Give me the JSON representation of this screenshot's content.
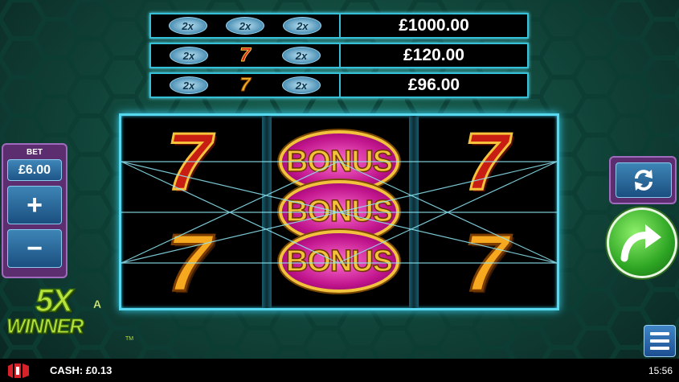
{
  "paytable": {
    "rows": [
      {
        "symbols": [
          "2x",
          "2x",
          "2x"
        ],
        "prize": "£1000.00"
      },
      {
        "symbols": [
          "2x",
          "7",
          "2x"
        ],
        "prize": "£120.00"
      },
      {
        "symbols": [
          "2x",
          "7",
          "2x"
        ],
        "prize": "£96.00"
      }
    ]
  },
  "reels": {
    "bonus_label": "BONUS",
    "seven_label": "7"
  },
  "bet": {
    "label": "BET",
    "value": "£6.00",
    "plus_label": "+",
    "minus_label": "−"
  },
  "logo": {
    "line1": "5X",
    "line1_small": "A",
    "line2": "WINNER",
    "tm": "TM"
  },
  "status": {
    "cash": "CASH: £0.13",
    "time": "15:56"
  },
  "colors": {
    "frame": "#58d8ee",
    "panel": "#5c2e70",
    "spin": "#2ea624",
    "button": "#1e5588"
  },
  "icons": [
    "refresh-icon",
    "spin-arrow-icon",
    "menu-icon",
    "brand-logo-icon"
  ]
}
